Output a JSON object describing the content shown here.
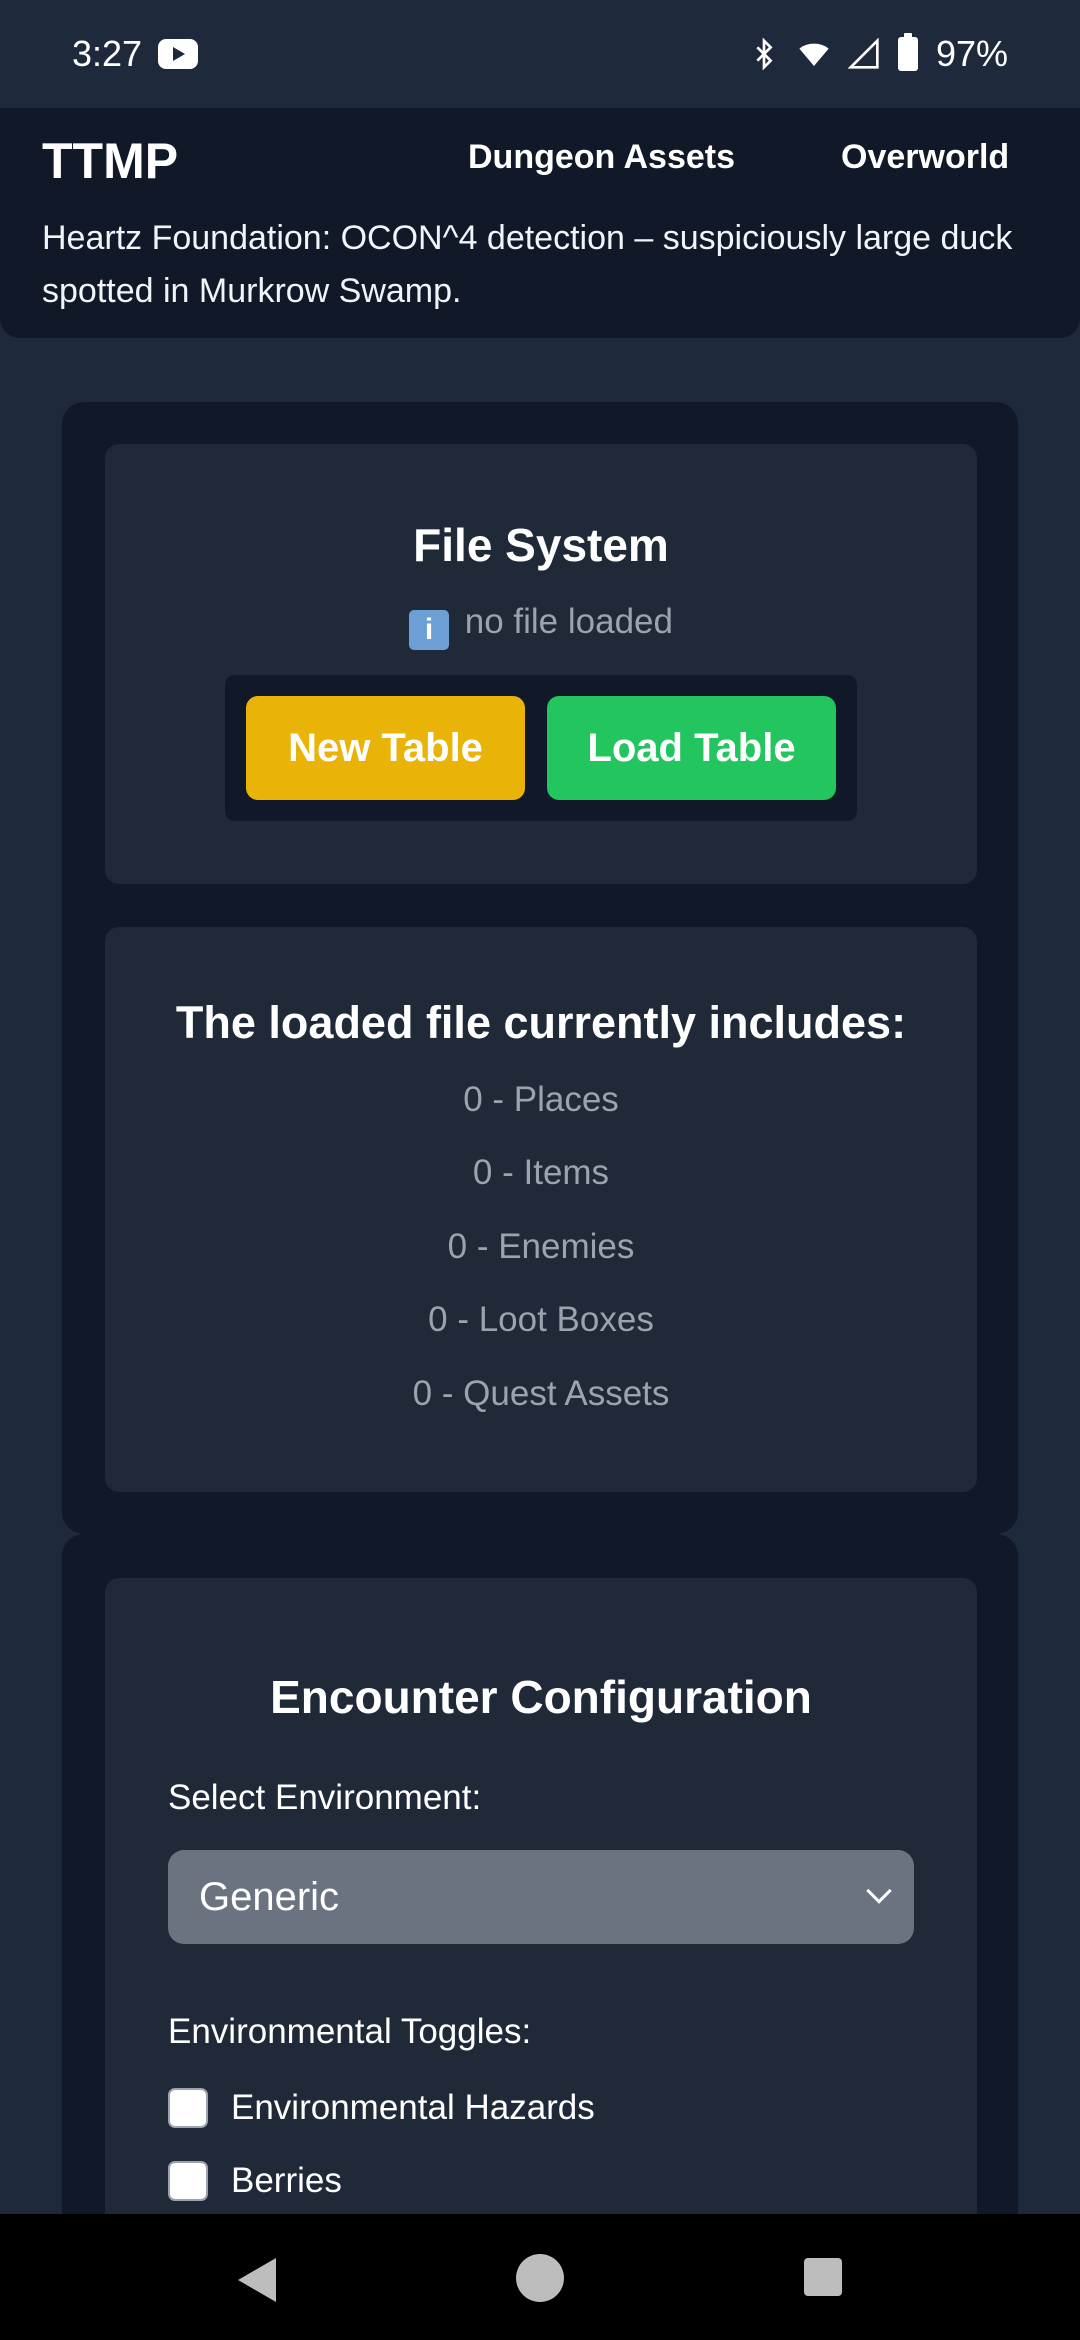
{
  "status_bar": {
    "time": "3:27",
    "battery": "97%"
  },
  "header": {
    "brand": "TTMP",
    "nav": [
      "Dungeon Assets",
      "Overworld"
    ],
    "ticker": "Heartz Foundation: OCON^4 detection – suspiciously large duck spotted in Murkrow Swamp."
  },
  "file_system": {
    "title": "File System",
    "status": "no file loaded",
    "new_button": "New Table",
    "load_button": "Load Table"
  },
  "includes": {
    "title": "The loaded file currently includes:",
    "items": [
      "0 - Places",
      "0 - Items",
      "0 - Enemies",
      "0 - Loot Boxes",
      "0 - Quest Assets"
    ]
  },
  "encounter": {
    "title": "Encounter Configuration",
    "env_label": "Select Environment:",
    "env_value": "Generic",
    "toggles_label": "Environmental Toggles:",
    "toggles": [
      {
        "label": "Environmental Hazards",
        "checked": false
      },
      {
        "label": "Berries",
        "checked": false
      }
    ]
  }
}
